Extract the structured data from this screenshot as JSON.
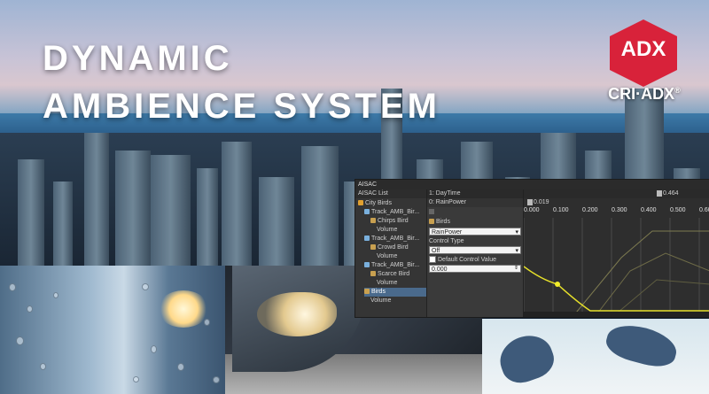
{
  "hero": {
    "title_line1": "DYNAMIC",
    "title_line2": "AMBIENCE SYSTEM"
  },
  "logo": {
    "badge_text": "ADX",
    "wordmark": "CRI·ADX",
    "registered": "®",
    "color": "#d8223a"
  },
  "aisac": {
    "window_title": "AISAC",
    "list_header": "AISAC List",
    "tree": [
      {
        "label": "City Birds",
        "icon": "folder-icon",
        "indent": 0
      },
      {
        "label": "Track_AMB_Bir...",
        "icon": "track-icon",
        "indent": 1
      },
      {
        "label": "Chirps Bird",
        "icon": "waveform-icon",
        "indent": 2
      },
      {
        "label": "Volume",
        "icon": "",
        "indent": 3
      },
      {
        "label": "Track_AMB_Bir...",
        "icon": "track-icon",
        "indent": 1
      },
      {
        "label": "Crowd Bird",
        "icon": "waveform-icon",
        "indent": 2
      },
      {
        "label": "Volume",
        "icon": "",
        "indent": 3
      },
      {
        "label": "Track_AMB_Bir...",
        "icon": "track-icon",
        "indent": 1
      },
      {
        "label": "Scarce Bird",
        "icon": "waveform-icon",
        "indent": 2
      },
      {
        "label": "Volume",
        "icon": "",
        "indent": 3
      },
      {
        "label": "Birds",
        "icon": "waveform-icon",
        "indent": 1
      },
      {
        "label": "Volume",
        "icon": "",
        "indent": 2
      }
    ],
    "param1": "1: DayTime",
    "param2": "0: RainPower",
    "marker_value": "0.464",
    "cursor_value": "0.019",
    "props": {
      "cue_name": "Birds",
      "aisac_control": "RainPower",
      "control_type_label": "Control Type",
      "control_type_value": "Off",
      "default_checkbox_label": "Default Control Value",
      "default_value": "0.000"
    },
    "axis_ticks": [
      "0.000",
      "0.100",
      "0.200",
      "0.300",
      "0.400",
      "0.500",
      "0.60"
    ]
  }
}
